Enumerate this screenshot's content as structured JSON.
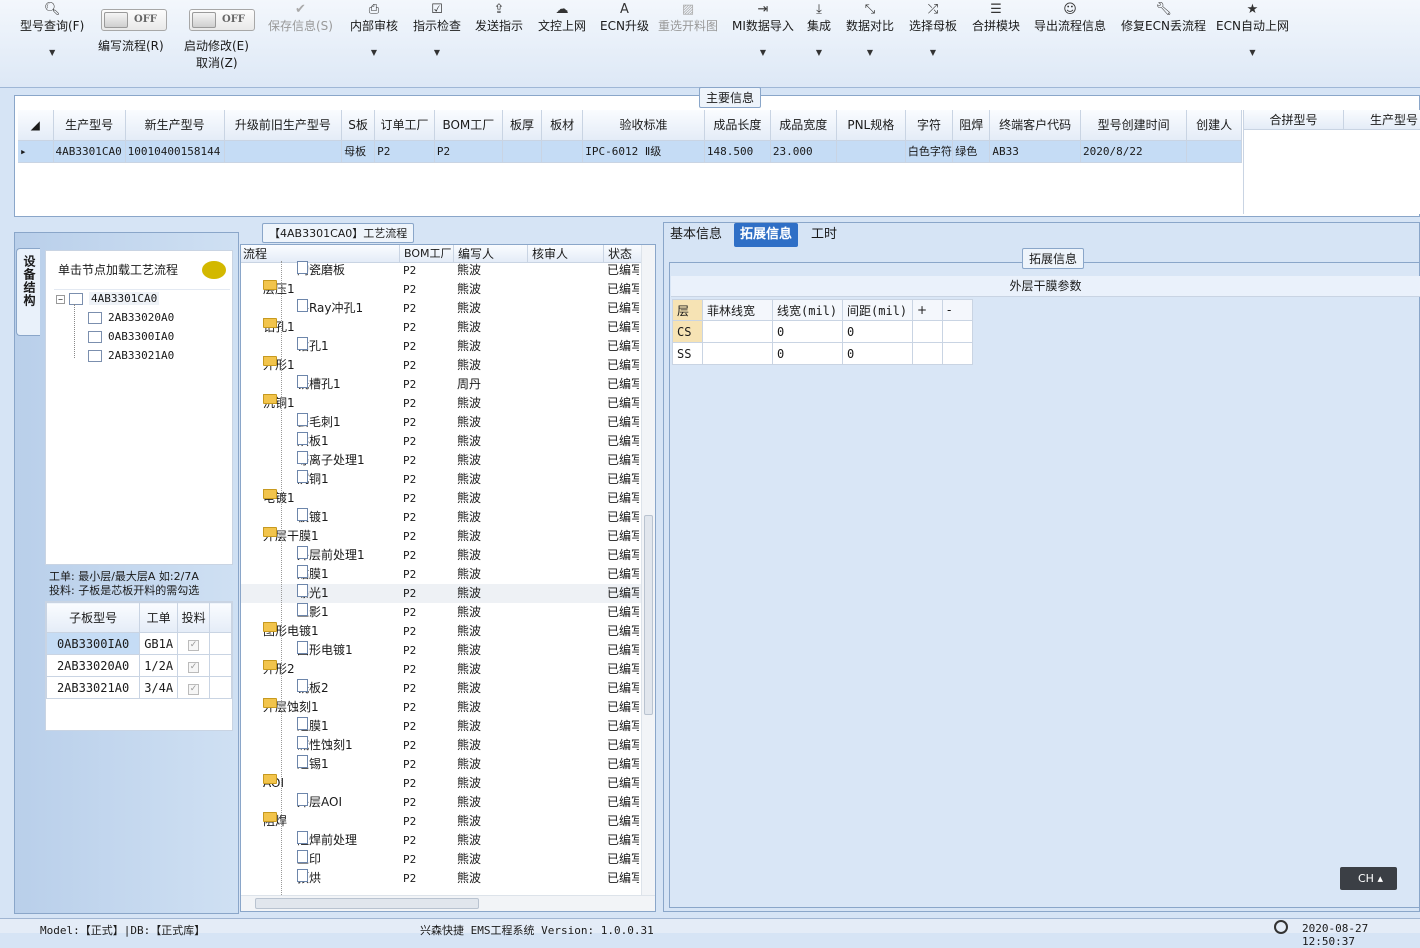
{
  "toolbar": {
    "query_label": "型号查询(F)",
    "write_flow_toggle": "OFF",
    "write_flow_label": "编写流程(R)",
    "start_edit_toggle": "OFF",
    "start_edit_label": "启动修改(E)",
    "cancel_label": "取消(Z)",
    "save_label": "保存信息(S)",
    "internal_review_label": "内部审核",
    "instr_check_label": "指示检查",
    "send_instr_label": "发送指示",
    "doc_online_label": "文控上网",
    "ecn_upgrade_label": "ECN升级",
    "reselect_label": "重选开料图",
    "mi_import_label": "MI数据导入",
    "integrate_label": "集成",
    "data_compare_label": "数据对比",
    "select_mother_label": "选择母板",
    "combine_label": "合拼模块",
    "export_flow_label": "导出流程信息",
    "fix_ecn_label": "修复ECN丢流程",
    "ecn_auto_label": "ECN自动上网"
  },
  "main_info": {
    "title": "主要信息",
    "columns": [
      "生产型号",
      "新生产型号",
      "升级前旧生产型号",
      "S板",
      "订单工厂",
      "BOM工厂",
      "板厚",
      "板材",
      "验收标准",
      "成品长度",
      "成品宽度",
      "PNL规格",
      "字符",
      "阻焊",
      "终端客户代码",
      "型号创建时间",
      "创建人"
    ],
    "row": [
      "4AB3301CA0",
      "10010400158144",
      "",
      "母板",
      "P2",
      "P2",
      "",
      "",
      "IPC-6012 Ⅱ级",
      "148.500",
      "23.000",
      "",
      "白色字符",
      "绿色",
      "AB33",
      "2020/8/22",
      ""
    ],
    "side_columns": [
      "合拼型号",
      "生产型号"
    ]
  },
  "sidebar": {
    "vertical_tab": "设备结构",
    "hint": "单击节点加载工艺流程",
    "tree": [
      "4AB3301CA0",
      "2AB33020A0",
      "0AB3300IA0",
      "2AB33021A0"
    ],
    "note_line1": "工单: 最小层/最大层A 如:2/7A",
    "note_line2": "投料: 子板是芯板开料的需勾选",
    "sub_columns": [
      "子板型号",
      "工单",
      "投料"
    ],
    "sub_rows": [
      [
        "0AB3300IA0",
        "GB1A"
      ],
      [
        "2AB33020A0",
        "1/2A"
      ],
      [
        "2AB33021A0",
        "3/4A"
      ]
    ]
  },
  "process": {
    "title": "【4AB3301CA0】工艺流程",
    "columns": [
      "流程",
      "BOM工厂",
      "编写人",
      "核审人",
      "状态"
    ],
    "rows": [
      {
        "name": "陶瓷磨板",
        "bom": "P2",
        "writer": "熊波",
        "status": "已编写",
        "level": 2
      },
      {
        "name": "层压1",
        "bom": "P2",
        "writer": "熊波",
        "status": "已编写",
        "level": 1
      },
      {
        "name": "X-Ray冲孔1",
        "bom": "P2",
        "writer": "熊波",
        "status": "已编写",
        "level": 2
      },
      {
        "name": "钻孔1",
        "bom": "P2",
        "writer": "熊波",
        "status": "已编写",
        "level": 1
      },
      {
        "name": "钻孔1",
        "bom": "P2",
        "writer": "熊波",
        "status": "已编写",
        "level": 2
      },
      {
        "name": "外形1",
        "bom": "P2",
        "writer": "熊波",
        "status": "已编写",
        "level": 1
      },
      {
        "name": "铣槽孔1",
        "bom": "P2",
        "writer": "周丹",
        "status": "已编写",
        "level": 2
      },
      {
        "name": "沉铜1",
        "bom": "P2",
        "writer": "熊波",
        "status": "已编写",
        "level": 1
      },
      {
        "name": "去毛刺1",
        "bom": "P2",
        "writer": "熊波",
        "status": "已编写",
        "level": 2
      },
      {
        "name": "烘板1",
        "bom": "P2",
        "writer": "熊波",
        "status": "已编写",
        "level": 2
      },
      {
        "name": "等离子处理1",
        "bom": "P2",
        "writer": "熊波",
        "status": "已编写",
        "level": 2
      },
      {
        "name": "沉铜1",
        "bom": "P2",
        "writer": "熊波",
        "status": "已编写",
        "level": 2
      },
      {
        "name": "电镀1",
        "bom": "P2",
        "writer": "熊波",
        "status": "已编写",
        "level": 1
      },
      {
        "name": "板镀1",
        "bom": "P2",
        "writer": "熊波",
        "status": "已编写",
        "level": 2
      },
      {
        "name": "外层干膜1",
        "bom": "P2",
        "writer": "熊波",
        "status": "已编写",
        "level": 1
      },
      {
        "name": "外层前处理1",
        "bom": "P2",
        "writer": "熊波",
        "status": "已编写",
        "level": 2
      },
      {
        "name": "贴膜1",
        "bom": "P2",
        "writer": "熊波",
        "status": "已编写",
        "level": 2
      },
      {
        "name": "曝光1",
        "bom": "P2",
        "writer": "熊波",
        "status": "已编写",
        "level": 2
      },
      {
        "name": "显影1",
        "bom": "P2",
        "writer": "熊波",
        "status": "已编写",
        "level": 2
      },
      {
        "name": "图形电镀1",
        "bom": "P2",
        "writer": "熊波",
        "status": "已编写",
        "level": 1
      },
      {
        "name": "图形电镀1",
        "bom": "P2",
        "writer": "熊波",
        "status": "已编写",
        "level": 2
      },
      {
        "name": "外形2",
        "bom": "P2",
        "writer": "熊波",
        "status": "已编写",
        "level": 1
      },
      {
        "name": "铣板2",
        "bom": "P2",
        "writer": "熊波",
        "status": "已编写",
        "level": 2
      },
      {
        "name": "外层蚀刻1",
        "bom": "P2",
        "writer": "熊波",
        "status": "已编写",
        "level": 1
      },
      {
        "name": "退膜1",
        "bom": "P2",
        "writer": "熊波",
        "status": "已编写",
        "level": 2
      },
      {
        "name": "碱性蚀刻1",
        "bom": "P2",
        "writer": "熊波",
        "status": "已编写",
        "level": 2
      },
      {
        "name": "退锡1",
        "bom": "P2",
        "writer": "熊波",
        "status": "已编写",
        "level": 2
      },
      {
        "name": "AOI",
        "bom": "P2",
        "writer": "熊波",
        "status": "已编写",
        "level": 1
      },
      {
        "name": "外层AOI",
        "bom": "P2",
        "writer": "熊波",
        "status": "已编写",
        "level": 2
      },
      {
        "name": "阻焊",
        "bom": "P2",
        "writer": "熊波",
        "status": "已编写",
        "level": 1
      },
      {
        "name": "阻焊前处理",
        "bom": "P2",
        "writer": "熊波",
        "status": "已编写",
        "level": 2
      },
      {
        "name": "丝印",
        "bom": "P2",
        "writer": "熊波",
        "status": "已编写",
        "level": 2
      },
      {
        "name": "预烘",
        "bom": "P2",
        "writer": "熊波",
        "status": "已编写",
        "level": 2
      }
    ]
  },
  "detail": {
    "tabs": [
      "基本信息",
      "拓展信息",
      "工时"
    ],
    "section_title": "拓展信息",
    "table_title": "外层干膜参数",
    "layer_columns": [
      "层",
      "菲林线宽",
      "线宽(mil)",
      "间距(mil)",
      "+",
      "-"
    ],
    "layer_rows": [
      [
        "CS",
        "",
        "0",
        "0"
      ],
      [
        "SS",
        "",
        "0",
        "0"
      ]
    ],
    "ime": "CH"
  },
  "status": {
    "model": "Model:【正式】|DB:【正式库】",
    "app": "兴森快捷 EMS工程系统 Version: 1.0.0.31",
    "time": "2020-08-27 12:50:37"
  }
}
